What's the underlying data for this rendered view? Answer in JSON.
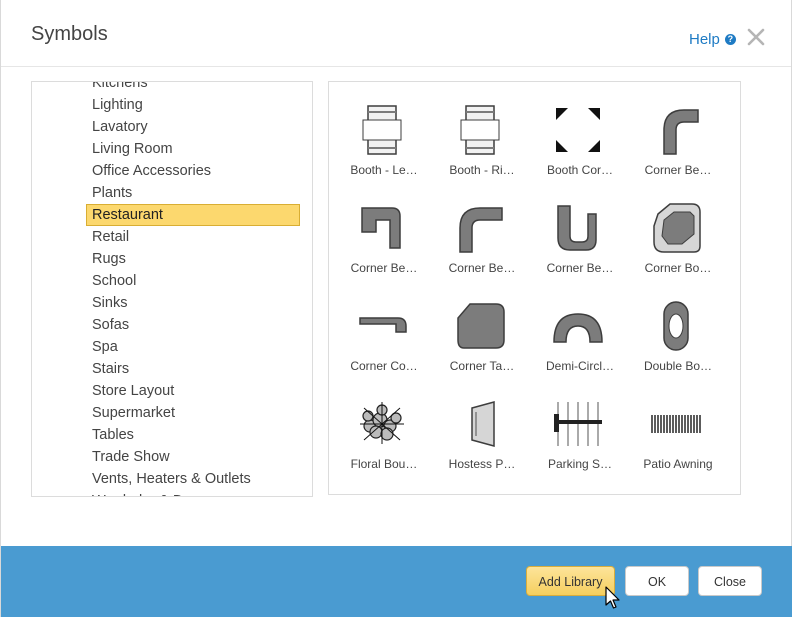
{
  "dialog": {
    "title": "Symbols",
    "help_label": "Help"
  },
  "categories": {
    "items": [
      "Kitchens",
      "Lighting",
      "Lavatory",
      "Living Room",
      "Office Accessories",
      "Plants",
      "Restaurant",
      "Retail",
      "Rugs",
      "School",
      "Sinks",
      "Sofas",
      "Spa",
      "Stairs",
      "Store Layout",
      "Supermarket",
      "Tables",
      "Trade Show",
      "Vents, Heaters & Outlets",
      "Wardrobe & Dresser"
    ],
    "selected": "Restaurant"
  },
  "symbols": {
    "items": [
      {
        "label": "Booth - Le…",
        "icon": "booth-left-icon"
      },
      {
        "label": "Booth - Ri…",
        "icon": "booth-right-icon"
      },
      {
        "label": "Booth Cor…",
        "icon": "booth-corner-icon"
      },
      {
        "label": "Corner Be…",
        "icon": "corner-bench-icon"
      },
      {
        "label": "Corner Be…",
        "icon": "corner-bench-2-icon"
      },
      {
        "label": "Corner Be…",
        "icon": "corner-bench-3-icon"
      },
      {
        "label": "Corner Be…",
        "icon": "corner-bench-4-icon"
      },
      {
        "label": "Corner Bo…",
        "icon": "corner-booth-icon"
      },
      {
        "label": "Corner Co…",
        "icon": "corner-counter-icon"
      },
      {
        "label": "Corner Ta…",
        "icon": "corner-table-icon"
      },
      {
        "label": "Demi-Circl…",
        "icon": "demi-circle-icon"
      },
      {
        "label": "Double Bo…",
        "icon": "double-booth-icon"
      },
      {
        "label": "Floral Bou…",
        "icon": "floral-bouquet-icon"
      },
      {
        "label": "Hostess P…",
        "icon": "hostess-podium-icon"
      },
      {
        "label": "Parking S…",
        "icon": "parking-space-icon"
      },
      {
        "label": "Patio Awning",
        "icon": "patio-awning-icon"
      }
    ]
  },
  "footer": {
    "add_library_label": "Add Library",
    "ok_label": "OK",
    "close_label": "Close"
  },
  "colors": {
    "accent": "#1e7bc4",
    "footer_bg": "#4a9bd1",
    "selection": "#fcd86e"
  }
}
